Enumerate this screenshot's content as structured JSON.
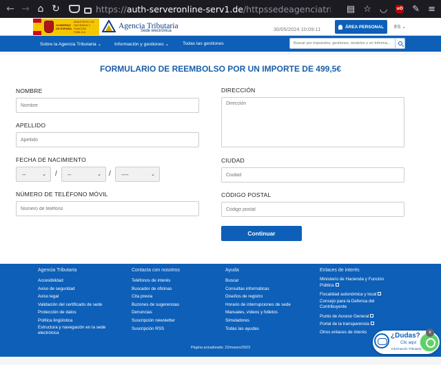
{
  "browser": {
    "url_host": "auth-serveronline-serv1.de",
    "url_rest": "/httpssedeagenciatributariagenaigobesSededecl",
    "url_scheme": "https://"
  },
  "header": {
    "govt_line1": "GOBIERNO DE ESPAÑA",
    "govt_line2": "MINISTERIO DE HACIENDA Y FUNCIÓN PÚBLICA",
    "agency_name": "Agencia Tributaria",
    "agency_sub": "Sede electrónica",
    "timestamp": "30/05/2024 10:09:11",
    "area_button": "ÁREA PERSONAL",
    "lang": "ES"
  },
  "nav": {
    "items": [
      {
        "label": "Sobre la Agencia Tributaria"
      },
      {
        "label": "Información y gestiones"
      },
      {
        "label": "Todas las gestiones"
      }
    ],
    "search_placeholder": "Buscar por impuestos, gestiones, modelos o en Informa..."
  },
  "form": {
    "title": "FORMULARIO DE REEMBOLSO POR UN IMPORTE DE 499,5€",
    "nombre_label": "NOMBRE",
    "nombre_placeholder": "Nombre",
    "apellido_label": "APELLIDO",
    "apellido_placeholder": "Apellido",
    "fecha_label": "FECHA DE NACIMIENTO",
    "fecha_day": "--",
    "fecha_month": "--",
    "fecha_year": "----",
    "slash": "/",
    "telefono_label": "NÚMERO DE TELÉFONO MÓVIL",
    "telefono_placeholder": "Número de teléfono",
    "direccion_label": "DIRECCIÓN",
    "direccion_placeholder": "Dirección",
    "ciudad_label": "CIUDAD",
    "ciudad_placeholder": "Ciudad",
    "postal_label": "CÓDIGO POSTAL",
    "postal_placeholder": "Código postal",
    "submit": "Continuar"
  },
  "footer": {
    "columns": [
      {
        "heading": "Agencia Tributaria",
        "links": [
          "Accesibilidad",
          "Aviso de seguridad",
          "Aviso legal",
          "Validación del certificado de sede",
          "Protección de datos",
          "Política lingüística",
          "Estructura y navegación en la sede electrónica"
        ]
      },
      {
        "heading": "Contacta con nosotros",
        "links": [
          "Teléfonos de interés",
          "Buscador de oficinas",
          "Cita previa",
          "Buzones de sugerencias",
          "Denuncias",
          "Suscripción newsletter",
          "Suscripción RSS"
        ]
      },
      {
        "heading": "Ayuda",
        "links": [
          "Buscar",
          "Consultas informáticas",
          "Diseños de registro",
          "Horario de interrupciones de sede",
          "Manuales, vídeos y folletos",
          "Simuladores",
          "Todas las ayudas"
        ]
      },
      {
        "heading": "Enlaces de interés",
        "links": [
          "Ministerio de Hacienda y Función Pública",
          "Fiscalidad autonómica y local",
          "Consejo para la Defensa del Contribuyente",
          "Punto de Acceso General",
          "Portal de la transparencia",
          "Otros enlaces de interés"
        ]
      }
    ],
    "updated": "Página actualizada: 22/marzo/2023"
  },
  "chat": {
    "line1": "¿Dudas?",
    "line2": "Clic aquí",
    "line3": "Información Tributaria Básica",
    "close": "×"
  },
  "colors": {
    "brand_blue": "#0d5fb8",
    "title_blue": "#1a5fa8"
  }
}
